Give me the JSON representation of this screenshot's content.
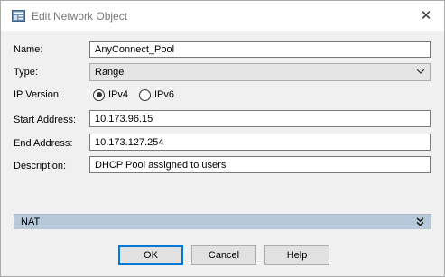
{
  "window": {
    "title": "Edit Network Object",
    "close_glyph": "✕",
    "icon": "network-object-icon"
  },
  "form": {
    "name_label": "Name:",
    "name_value": "AnyConnect_Pool",
    "type_label": "Type:",
    "type_value": "Range",
    "ip_version_label": "IP Version:",
    "ipv4_label": "IPv4",
    "ipv6_label": "IPv6",
    "ip_version_selected": "IPv4",
    "start_label": "Start Address:",
    "start_value": "10.173.96.15",
    "end_label": "End Address:",
    "end_value": "10.173.127.254",
    "description_label": "Description:",
    "description_value": "DHCP Pool assigned to users"
  },
  "nat": {
    "label": "NAT",
    "toggle_icon": "double-chevron-down-icon"
  },
  "buttons": {
    "ok": "OK",
    "cancel": "Cancel",
    "help": "Help"
  },
  "colors": {
    "accent": "#0078d7",
    "nat_bar": "#b7c8da",
    "dialog_bg": "#f0f0f0"
  }
}
